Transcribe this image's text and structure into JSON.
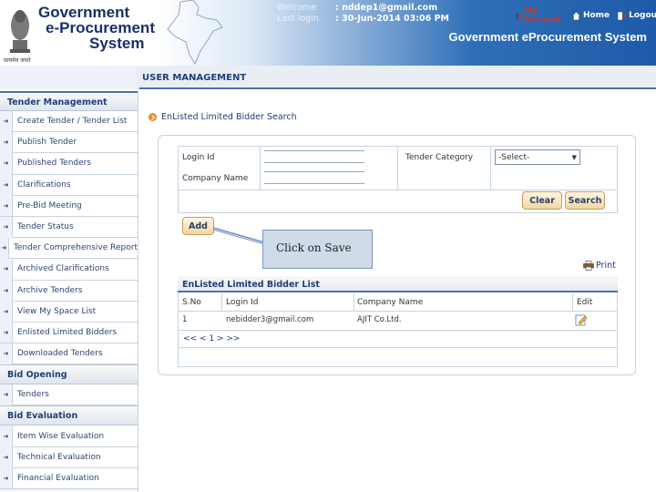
{
  "header": {
    "logo_lines": [
      "Government",
      "e-Procurement",
      "System"
    ],
    "emblem_caption": "सत्यमेव जयते",
    "user": {
      "welcome_label": "Welcome",
      "welcome_value": ":  nddep1@gmail.com",
      "lastlogin_label": "Last login",
      "lastlogin_value": ":  30-Jun-2014 03:06 PM"
    },
    "links": {
      "account": "My Account",
      "home": "Home",
      "logout": "Logout"
    },
    "system_title": "Government eProcurement System"
  },
  "page_title": "USER MANAGEMENT",
  "sidebar": {
    "sections": [
      {
        "title": "Tender Management",
        "items": [
          "Create Tender / Tender List",
          "Publish Tender",
          "Published Tenders",
          "Clarifications",
          "Pre-Bid Meeting",
          "Tender Status",
          "Tender Comprehensive Report",
          "Archived Clarifications",
          "Archive Tenders",
          "View My Space List",
          "Enlisted Limited Bidders",
          "Downloaded Tenders"
        ]
      },
      {
        "title": "Bid Opening",
        "items": [
          "Tenders"
        ]
      },
      {
        "title": "Bid Evaluation",
        "items": [
          "Item Wise Evaluation",
          "Technical Evaluation",
          "Financial Evaluation"
        ]
      }
    ]
  },
  "search": {
    "crumb": "EnListed Limited Bidder Search",
    "login_id_label": "Login Id",
    "company_name_label": "Company Name",
    "tender_category_label": "Tender Category",
    "tender_category_value": "-Select-",
    "clear_label": "Clear",
    "search_label": "Search",
    "add_label": "Add"
  },
  "callout": "Click on Save",
  "print_label": "Print",
  "list": {
    "title": "EnListed Limited Bidder List",
    "columns": [
      "S.No",
      "Login Id",
      "Company Name",
      "Edit"
    ],
    "rows": [
      {
        "sno": "1",
        "login": "nebidder3@gmail.com",
        "company": "AJIT Co.Ltd."
      }
    ],
    "pager": "<< < 1 > >>"
  },
  "colors": {
    "brand_blue": "#1e5aa8",
    "accent_orange": "#e88a1a",
    "navy_text": "#1e3f76"
  }
}
